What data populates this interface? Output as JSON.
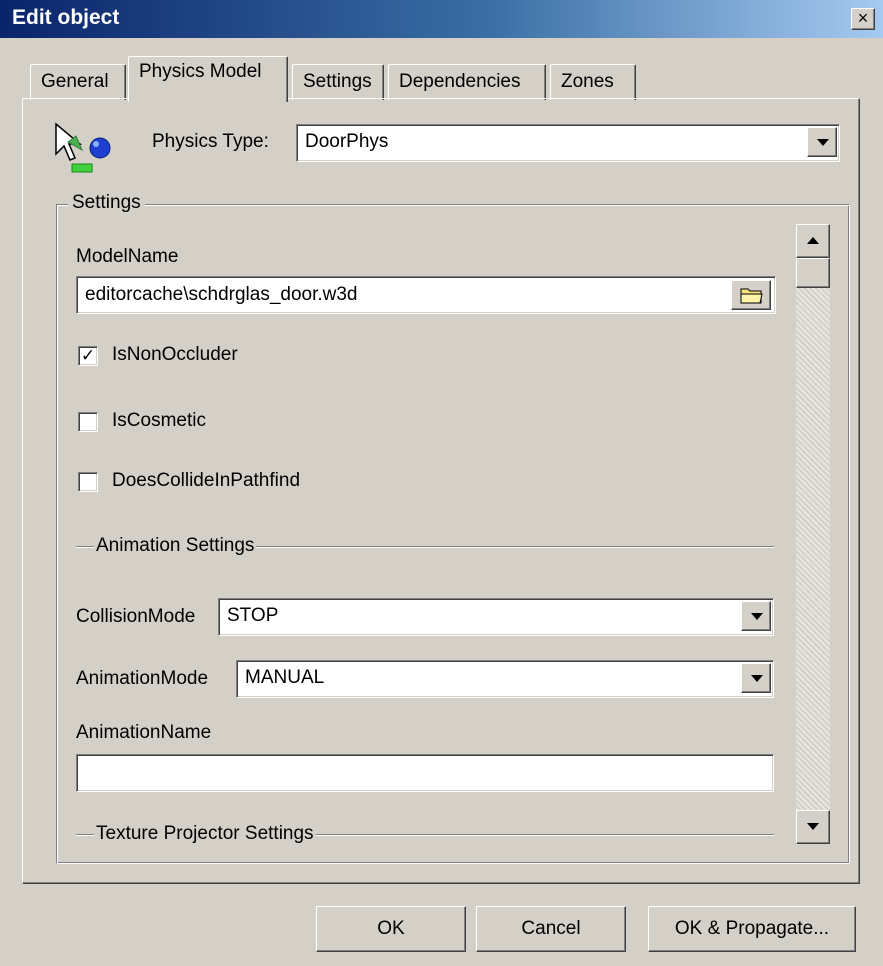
{
  "window": {
    "title": "Edit object",
    "close_glyph": "×"
  },
  "tabs": [
    {
      "label": "General",
      "active": false
    },
    {
      "label": "Physics Model",
      "active": true
    },
    {
      "label": "Settings",
      "active": false
    },
    {
      "label": "Dependencies",
      "active": false
    },
    {
      "label": "Zones",
      "active": false
    }
  ],
  "physics": {
    "icon": "physics-model-icon",
    "type_label": "Physics Type:",
    "type_value": "DoorPhys"
  },
  "settings": {
    "group_label": "Settings",
    "model_name_label": "ModelName",
    "model_name_value": "editorcache\\schdrglas_door.w3d",
    "browse_icon": "folder-icon",
    "checkboxes": [
      {
        "label": "IsNonOccluder",
        "checked": true,
        "mark": "✓"
      },
      {
        "label": "IsCosmetic",
        "checked": false,
        "mark": ""
      },
      {
        "label": "DoesCollideInPathfind",
        "checked": false,
        "mark": ""
      }
    ],
    "animation_section_label": "Animation Settings",
    "collision_mode_label": "CollisionMode",
    "collision_mode_value": "STOP",
    "animation_mode_label": "AnimationMode",
    "animation_mode_value": "MANUAL",
    "animation_name_label": "AnimationName",
    "animation_name_value": "",
    "texture_section_label": "Texture Projector Settings"
  },
  "buttons": {
    "ok": "OK",
    "cancel": "Cancel",
    "ok_propagate": "OK & Propagate..."
  }
}
